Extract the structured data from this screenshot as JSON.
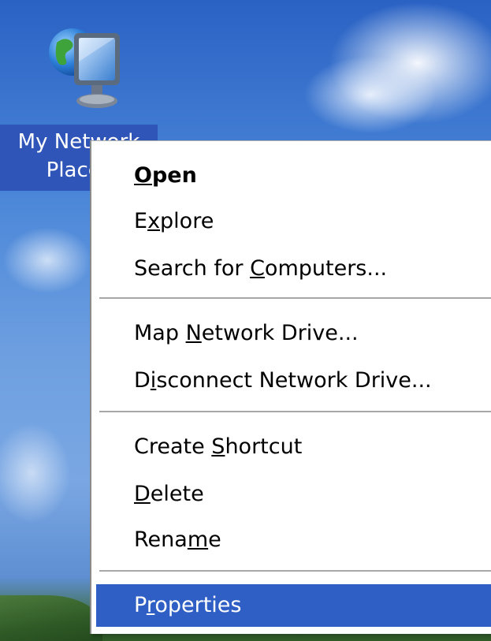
{
  "desktop": {
    "icon": {
      "name": "network-places-icon",
      "label_line1": "My Network",
      "label_line2": "Places",
      "selected_color": "#2f55b8"
    }
  },
  "context_menu": {
    "items": [
      {
        "pre": "",
        "accel": "O",
        "post": "pen",
        "bold": true
      },
      {
        "pre": "E",
        "accel": "x",
        "post": "plore"
      },
      {
        "pre": "Search for ",
        "accel": "C",
        "post": "omputers..."
      },
      {
        "pre": "Map ",
        "accel": "N",
        "post": "etwork Drive..."
      },
      {
        "pre": "D",
        "accel": "i",
        "post": "sconnect Network Drive..."
      },
      {
        "pre": "Create ",
        "accel": "S",
        "post": "hortcut"
      },
      {
        "pre": "",
        "accel": "D",
        "post": "elete"
      },
      {
        "pre": "Rena",
        "accel": "m",
        "post": "e"
      },
      {
        "pre": "P",
        "accel": "r",
        "post": "operties",
        "highlighted": true
      }
    ],
    "highlight_color": "#2f5fc4"
  }
}
